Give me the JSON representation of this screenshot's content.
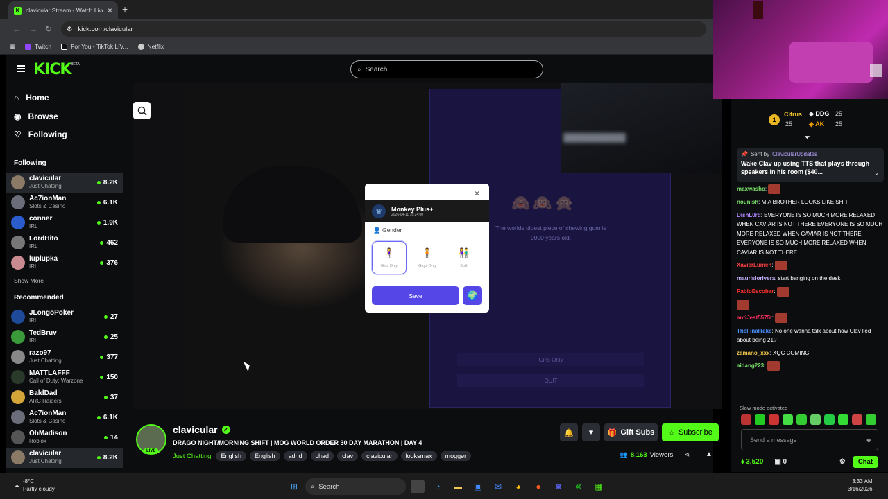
{
  "browser": {
    "tab_title": "clavicular Stream - Watch Live o",
    "url": "kick.com/clavicular",
    "bookmarks": [
      {
        "label": "Twitch",
        "color": "#9146ff"
      },
      {
        "label": "For You - TikTok LIV...",
        "color": "#ffffff"
      },
      {
        "label": "Netflix",
        "color": "#cccccc"
      }
    ]
  },
  "topnav": {
    "logo": "KICK",
    "beta": "BETA",
    "search_placeholder": "Search"
  },
  "sidebar": {
    "main_nav": [
      {
        "label": "Home",
        "icon": "home-icon"
      },
      {
        "label": "Browse",
        "icon": "compass-icon"
      },
      {
        "label": "Following",
        "icon": "heart-icon"
      }
    ],
    "following_title": "Following",
    "following": [
      {
        "name": "clavicular",
        "category": "Just Chatting",
        "viewers": "8.2K",
        "color": "#8a7a66"
      },
      {
        "name": "Ac7ionMan",
        "category": "Slots & Casino",
        "viewers": "6.1K",
        "color": "#6b6e7a"
      },
      {
        "name": "conner",
        "category": "IRL",
        "viewers": "1.9K",
        "color": "#2b5ccc"
      },
      {
        "name": "LordHito",
        "category": "IRL",
        "viewers": "462",
        "color": "#777"
      },
      {
        "name": "luplupka",
        "category": "IRL",
        "viewers": "376",
        "color": "#c98a90"
      }
    ],
    "show_more": "Show More",
    "recommended_title": "Recommended",
    "recommended": [
      {
        "name": "JLongoPoker",
        "category": "IRL",
        "viewers": "27",
        "color": "#1f4a9a"
      },
      {
        "name": "TedBruv",
        "category": "IRL",
        "viewers": "25",
        "color": "#3a9a3a"
      },
      {
        "name": "razo97",
        "category": "Just Chatting",
        "viewers": "377",
        "color": "#888"
      },
      {
        "name": "MATTLAFFF",
        "category": "Call of Duty: Warzone",
        "viewers": "150",
        "color": "#2a3a2a"
      },
      {
        "name": "BaldDad",
        "category": "ARC Raiders",
        "viewers": "37",
        "color": "#d4a63a"
      },
      {
        "name": "Ac7ionMan",
        "category": "Slots & Casino",
        "viewers": "6.1K",
        "color": "#6b6e7a"
      },
      {
        "name": "OhMadison",
        "category": "Roblox",
        "viewers": "14",
        "color": "#555"
      },
      {
        "name": "clavicular",
        "category": "Just Chatting",
        "viewers": "8.2K",
        "color": "#8a7a66"
      }
    ]
  },
  "video": {
    "fact": "The worlds oldest piece of chewing gum is 9000 years old.",
    "monkeys": "🙈🙉🙊",
    "dim_option": "Girls Only",
    "quit": "QUIT"
  },
  "modal": {
    "title": "Monkey Plus+",
    "date": "2026-04-11 16:24:00",
    "gender_label": "Gender",
    "options": [
      {
        "label": "Girls Only",
        "icon": "🧍‍♀️"
      },
      {
        "label": "Guys Only",
        "icon": "🧍"
      },
      {
        "label": "Both",
        "icon": "👫"
      }
    ],
    "save": "Save",
    "close": "×"
  },
  "stream": {
    "name": "clavicular",
    "live": "LIVE",
    "title": "DRAGO NIGHT/MORNING SHIFT | MOG WORLD ORDER 30 DAY MARATHON | DAY 4",
    "category": "Just Chatting",
    "tags": [
      "English",
      "English",
      "adhd",
      "chad",
      "clav",
      "clavicular",
      "looksmax",
      "mogger"
    ],
    "gift_subs": "Gift Subs",
    "subscribe": "Subscribe",
    "viewers": "8,163",
    "viewers_label": "Viewers"
  },
  "chat": {
    "top_gifters": [
      {
        "rank": "1",
        "name": "Citrus",
        "count": "25"
      },
      {
        "name": "DDG",
        "count": "25"
      },
      {
        "name": "AK",
        "count": "25"
      }
    ],
    "pinned_by_label": "Sent by",
    "pinned_by": "ClavicularUpdates",
    "pinned_text": "Wake Clav up using TTS that plays through speakers in his room ($40...",
    "messages": [
      {
        "user": "maxwasho",
        "color": "#7be36b",
        "text": ""
      },
      {
        "user": "nounish",
        "color": "#7be36b",
        "text": "MIA BROTHER LOOKS LIKE SHIT"
      },
      {
        "user": "DishL0rd",
        "color": "#b08aff",
        "text": "EVERYONE IS SO MUCH MORE RELAXED WHEN CAVIAR IS NOT THERE EVERYONE IS SO MUCH MORE RELAXED WHEN CAVIAR IS NOT THERE EVERYONE IS SO MUCH MORE RELAXED WHEN CAVIAR IS NOT THERE"
      },
      {
        "user": "XavierLumen",
        "color": "#ff4040",
        "text": ""
      },
      {
        "user": "maurisiorivera",
        "color": "#c9b3ff",
        "text": "start banging on the desk"
      },
      {
        "user": "PabloEscobar",
        "color": "#ff3030",
        "text": ""
      },
      {
        "user": "",
        "color": "#fff",
        "text": ""
      },
      {
        "user": "antiJest5575t",
        "color": "#ff3060",
        "text": ""
      },
      {
        "user": "TheFinalTake",
        "color": "#4a90ff",
        "text": "No one wanna talk about how Clav lied about being 21?"
      },
      {
        "user": "zamano_xxx",
        "color": "#f2c94c",
        "text": "XQC COMING"
      },
      {
        "user": "aidang223",
        "color": "#7be36b",
        "text": ""
      }
    ],
    "slow_mode": "Slow mode activated",
    "input_placeholder": "Send a message",
    "points": "3,520",
    "badges": "0",
    "chat_button": "Chat"
  },
  "taskbar": {
    "temp": "-8°C",
    "weather": "Partly cloudy",
    "search": "Search",
    "time": "3:33 AM",
    "date": "3/16/2026"
  }
}
